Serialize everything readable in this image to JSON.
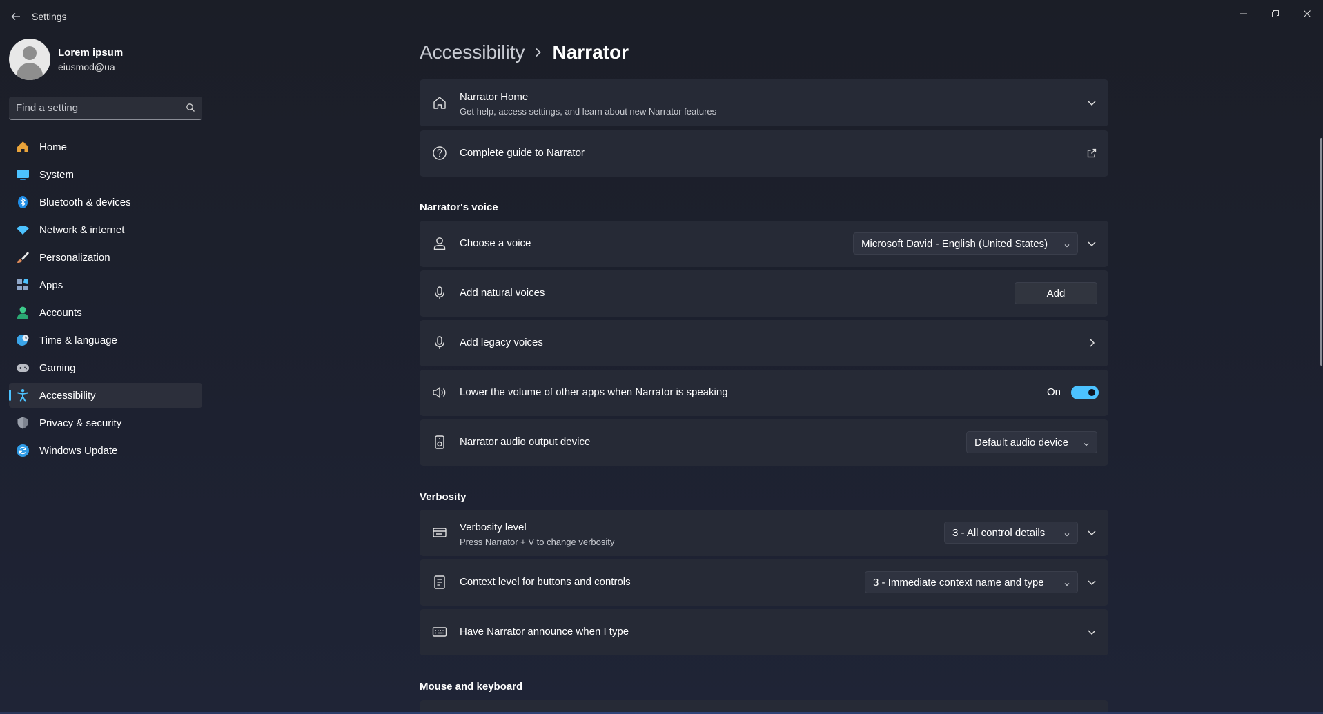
{
  "window": {
    "title": "Settings"
  },
  "profile": {
    "name": "Lorem ipsum",
    "email": "eiusmod@ua"
  },
  "search": {
    "placeholder": "Find a setting"
  },
  "sidebar": {
    "items": [
      {
        "label": "Home",
        "icon": "home-icon",
        "color": "#e8a33b"
      },
      {
        "label": "System",
        "icon": "system-icon",
        "color": "#4cc2ff"
      },
      {
        "label": "Bluetooth & devices",
        "icon": "bluetooth-icon",
        "color": "#1f8de6"
      },
      {
        "label": "Network & internet",
        "icon": "wifi-icon",
        "color": "#4cc2ff"
      },
      {
        "label": "Personalization",
        "icon": "brush-icon",
        "color": "#e08c5a"
      },
      {
        "label": "Apps",
        "icon": "apps-icon",
        "color": "#8ea6c8"
      },
      {
        "label": "Accounts",
        "icon": "person-icon",
        "color": "#3cc98a"
      },
      {
        "label": "Time & language",
        "icon": "globe-clock-icon",
        "color": "#3aa4e8"
      },
      {
        "label": "Gaming",
        "icon": "controller-icon",
        "color": "#b9bcc4"
      },
      {
        "label": "Accessibility",
        "icon": "accessibility-icon",
        "color": "#4cc2ff",
        "active": true
      },
      {
        "label": "Privacy & security",
        "icon": "shield-icon",
        "color": "#9aa0ab"
      },
      {
        "label": "Windows Update",
        "icon": "update-icon",
        "color": "#2f9be6"
      }
    ]
  },
  "breadcrumb": {
    "parent": "Accessibility",
    "current": "Narrator"
  },
  "cards": {
    "home": {
      "title": "Narrator Home",
      "subtitle": "Get help, access settings, and learn about new Narrator features"
    },
    "guide": {
      "title": "Complete guide to Narrator"
    },
    "choose_voice": {
      "title": "Choose a voice",
      "value": "Microsoft David - English (United States)"
    },
    "natural_voices": {
      "title": "Add natural voices",
      "button": "Add"
    },
    "legacy_voices": {
      "title": "Add legacy voices"
    },
    "lower_volume": {
      "title": "Lower the volume of other apps when Narrator is speaking",
      "state_label": "On",
      "on": true
    },
    "audio_output": {
      "title": "Narrator audio output device",
      "value": "Default audio device"
    },
    "verbosity": {
      "title": "Verbosity level",
      "subtitle": "Press Narrator + V to change verbosity",
      "value": "3 - All control details"
    },
    "context": {
      "title": "Context level for buttons and controls",
      "value": "3 - Immediate context name and type"
    },
    "typing": {
      "title": "Have Narrator announce when I type"
    }
  },
  "sections": {
    "voice": "Narrator's voice",
    "verbosity": "Verbosity",
    "mouse_keyboard": "Mouse and keyboard"
  },
  "colors": {
    "accent": "#4cc2ff",
    "card": "#262a36",
    "background": "#1d2130"
  }
}
